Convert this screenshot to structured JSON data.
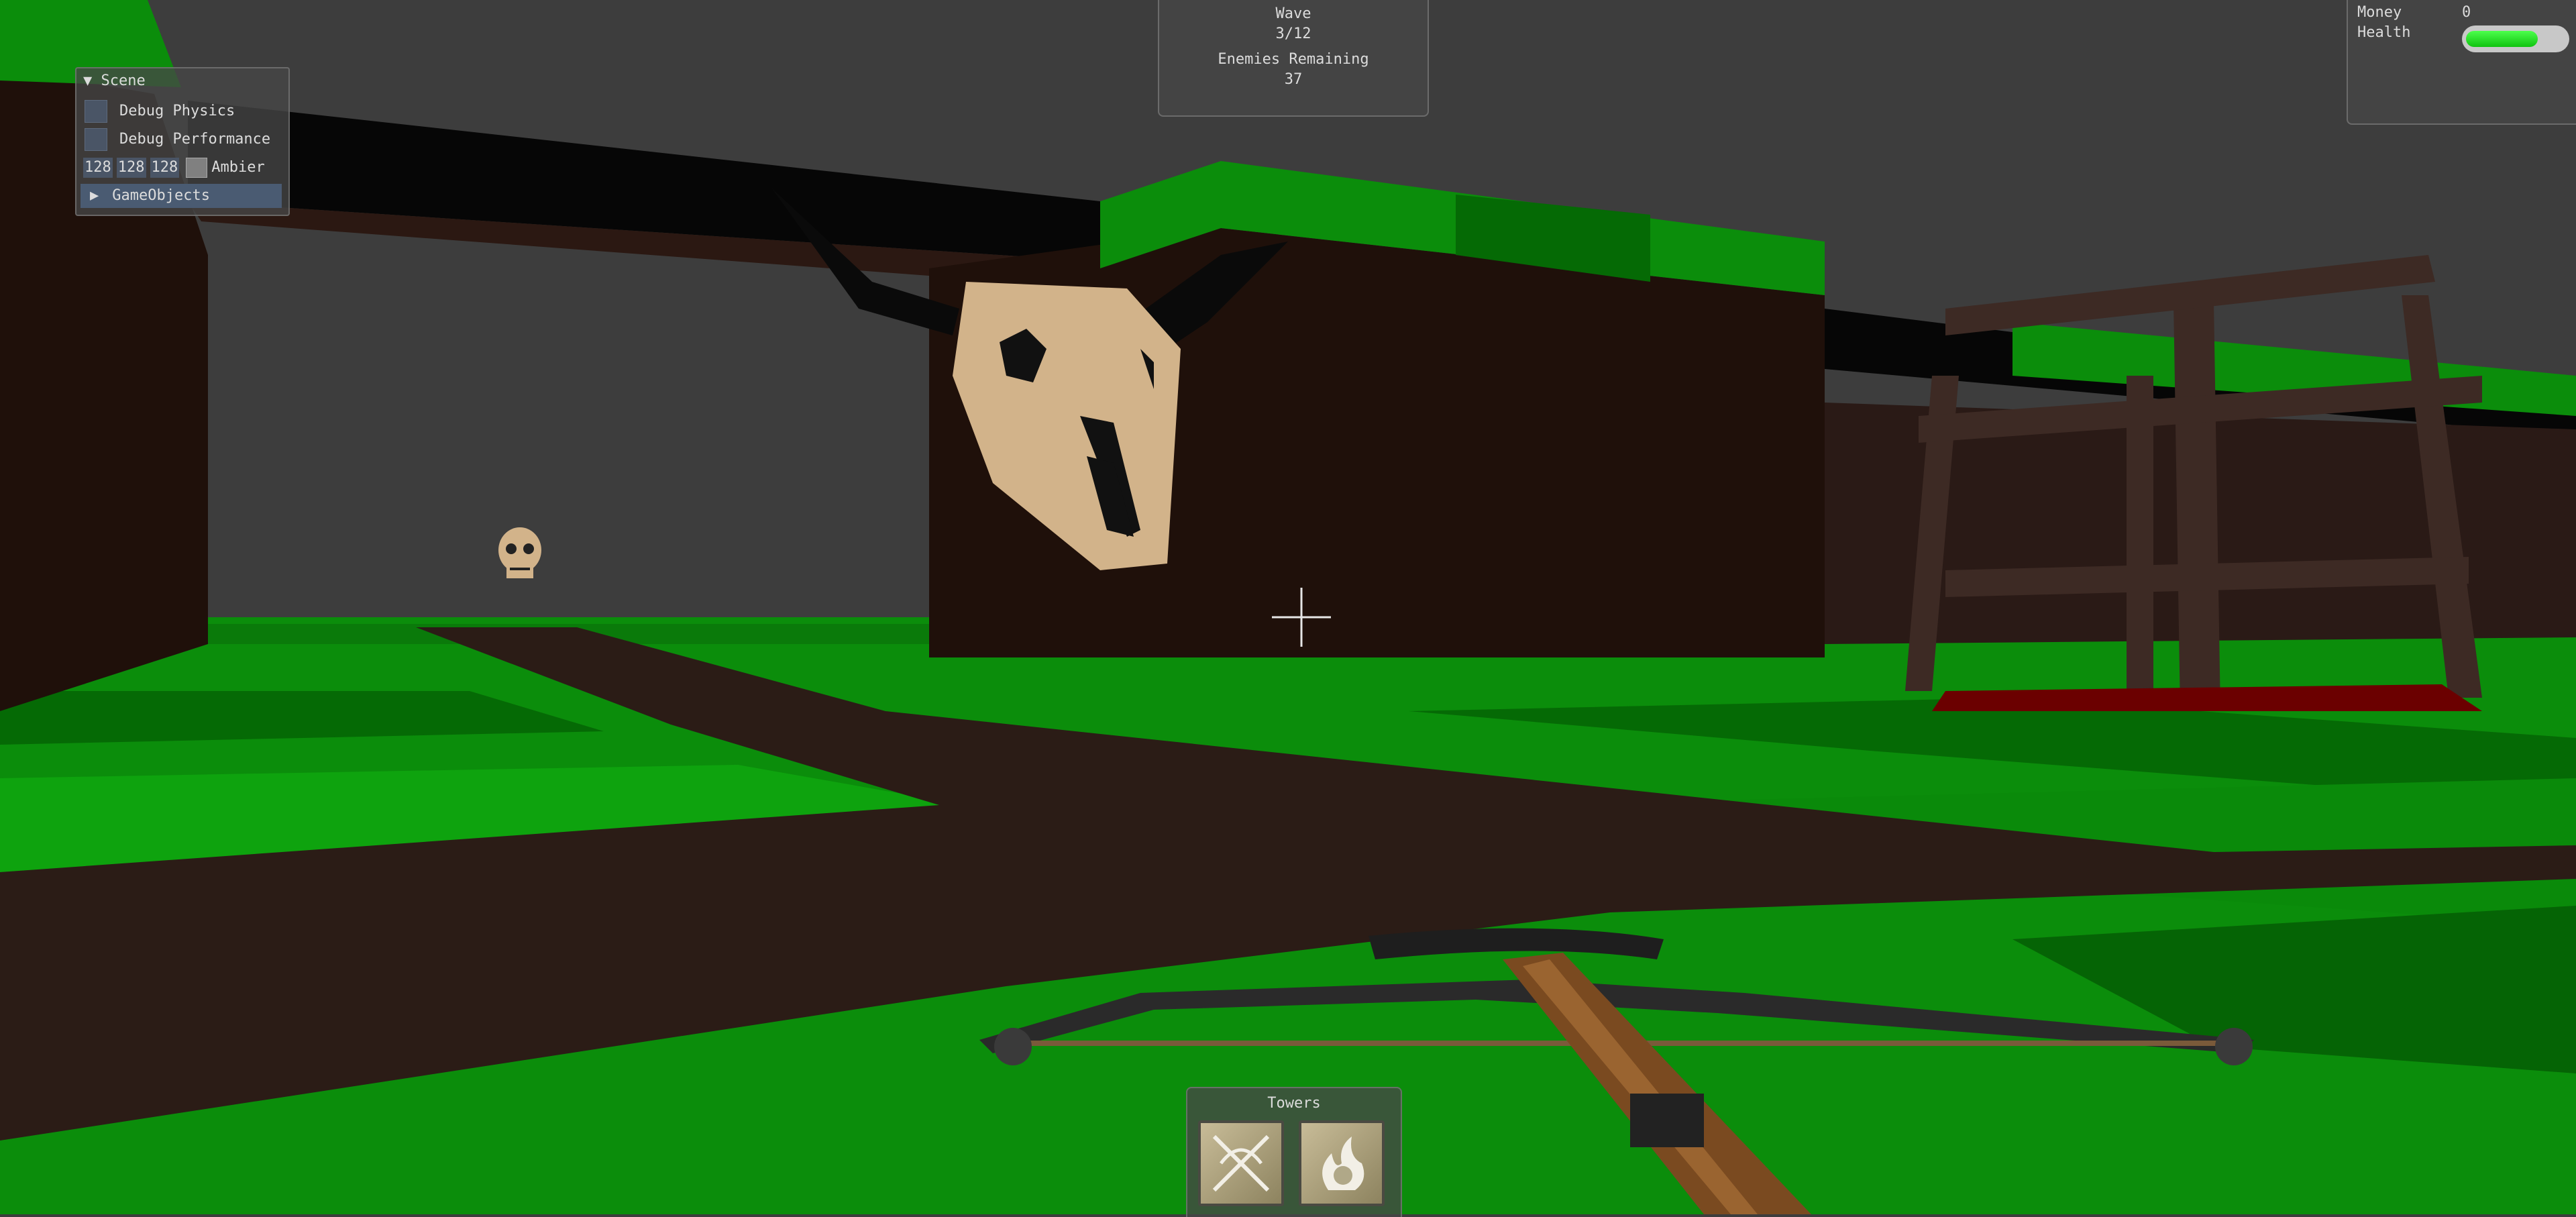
{
  "scene_window": {
    "title": "Scene",
    "collapse_arrow": "triangle-down-icon",
    "debug_physics_label": "Debug Physics",
    "debug_performance_label": "Debug Performance",
    "ambient_r": "128",
    "ambient_g": "128",
    "ambient_b": "128",
    "ambient_label": "Ambier",
    "gameobjects_label": "GameObjects",
    "expand_arrow": "triangle-right-icon"
  },
  "hud": {
    "wave_label": "Wave",
    "wave_value": "3/12",
    "enemies_label": "Enemies Remaining",
    "enemies_value": "37",
    "money_label": "Money",
    "money_value": "0",
    "health_label": "Health",
    "health_fraction": 0.72,
    "towers_label": "Towers",
    "tower_icons": [
      "crossbow-tower-icon",
      "fire-tower-icon"
    ]
  },
  "colors": {
    "sky": "#3d3d3d",
    "grass_light": "#0e9a0e",
    "grass_dark": "#056605",
    "path": "#2b1c16",
    "wall": "#1f100a",
    "skull": "#d2b38a",
    "health": "#22dd22"
  }
}
